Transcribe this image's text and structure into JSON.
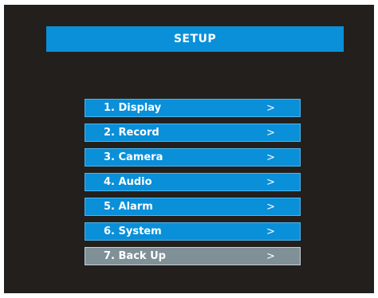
{
  "title": "SETUP",
  "menu": {
    "items": [
      {
        "label": "1. Display",
        "arrow": ">"
      },
      {
        "label": "2. Record",
        "arrow": ">"
      },
      {
        "label": "3. Camera",
        "arrow": ">"
      },
      {
        "label": "4. Audio",
        "arrow": ">"
      },
      {
        "label": "5. Alarm",
        "arrow": ">"
      },
      {
        "label": "6. System",
        "arrow": ">"
      },
      {
        "label": "7. Back Up",
        "arrow": ">"
      }
    ],
    "selected_index": 6
  },
  "colors": {
    "screen_background": "#231f1c",
    "accent": "#0a8fd9",
    "selected": "#7f9097",
    "text": "#ffffff"
  }
}
